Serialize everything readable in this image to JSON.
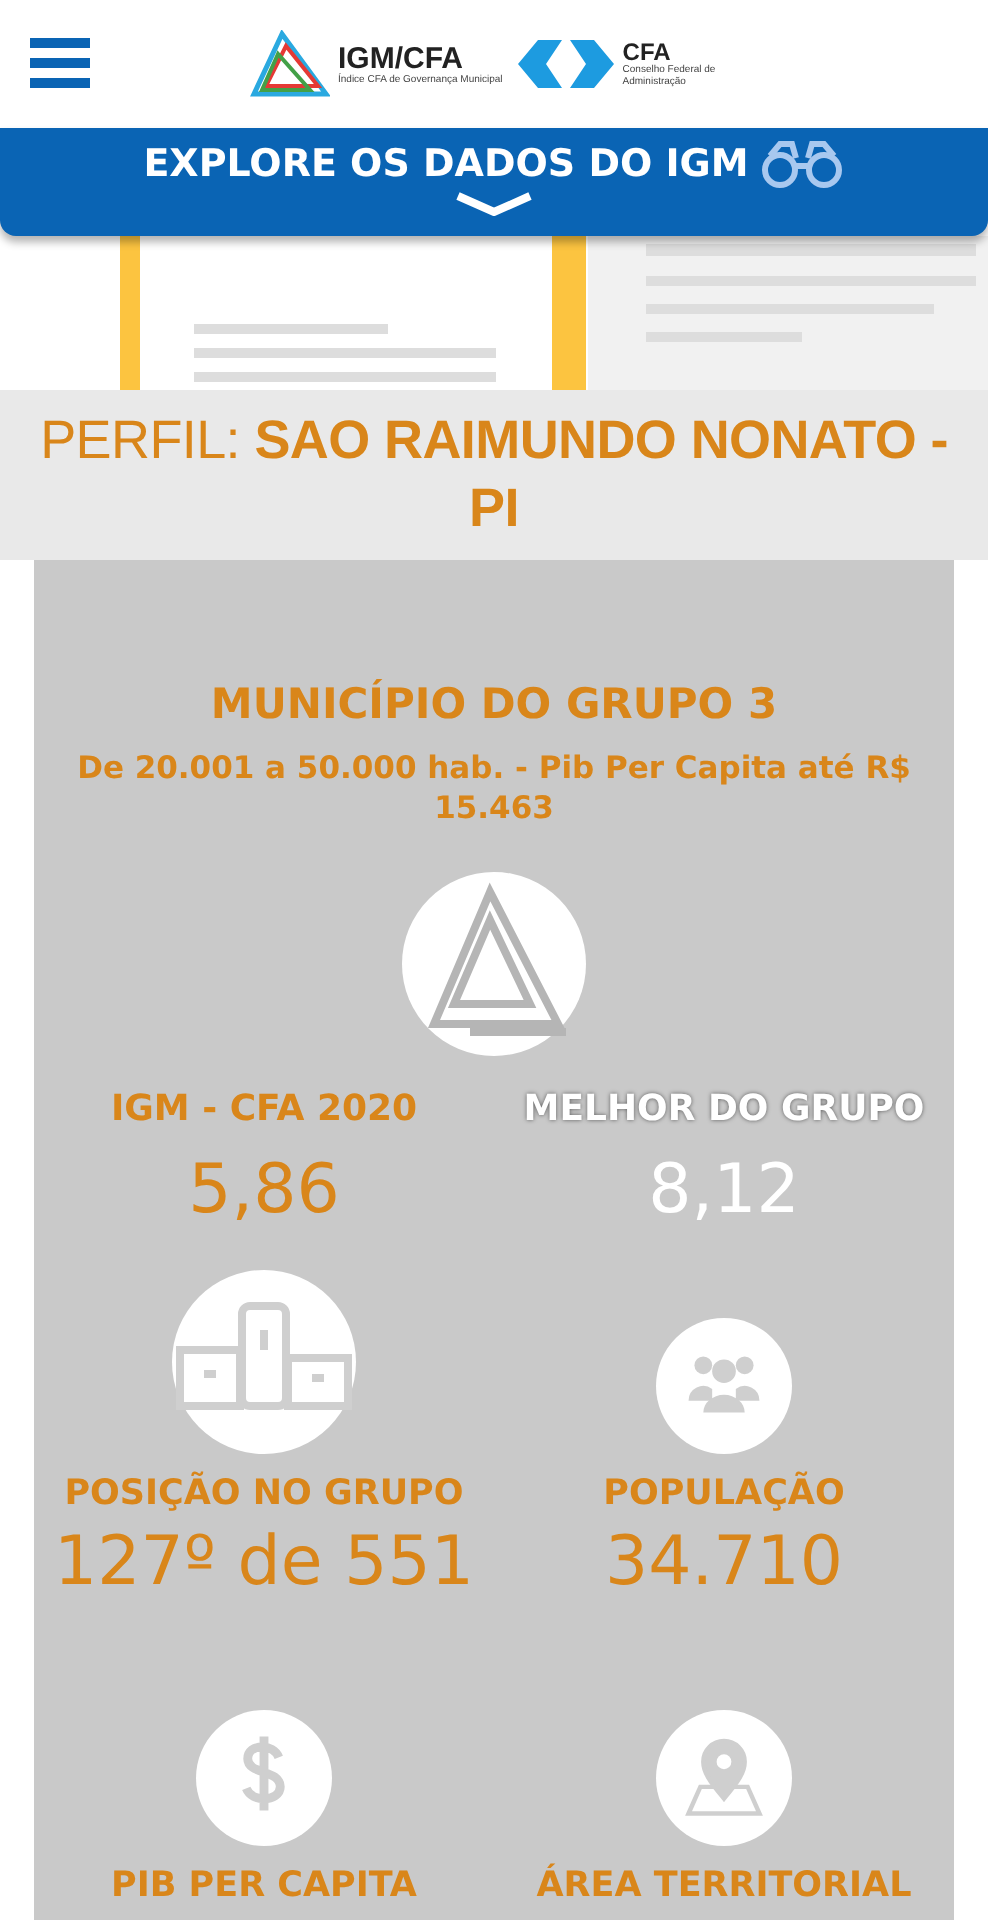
{
  "header": {
    "logo_title": "IGM/CFA",
    "logo_subtitle": "Índice CFA de Governança Municipal",
    "partner_title": "CFA",
    "partner_subtitle": "Conselho Federal de Administração"
  },
  "explore_bar": {
    "label": "EXPLORE OS DADOS DO IGM"
  },
  "profile": {
    "title": "PERFIL: **SAO RAIMUNDO NONATO - PI**"
  },
  "group": {
    "title": "MUNICÍPIO DO GRUPO 3",
    "subtitle": "De 20.001 a 50.000 hab. - Pib Per Capita até R$ 15.463"
  },
  "scores": [
    {
      "label": "IGM - CFA 2020",
      "value": "5,86",
      "highlight": true
    },
    {
      "label": "MELHOR DO GRUPO",
      "value": "8,12",
      "highlight": false
    }
  ],
  "indicators": [
    {
      "kind": "podium",
      "label": "POSIÇÃO NO GRUPO",
      "value": "127º de 551"
    },
    {
      "kind": "people",
      "label": "POPULAÇÃO",
      "value": "34.710"
    },
    {
      "kind": "money",
      "label": "PIB PER CAPITA"
    },
    {
      "kind": "map",
      "label": "ÁREA TERRITORIAL"
    }
  ]
}
